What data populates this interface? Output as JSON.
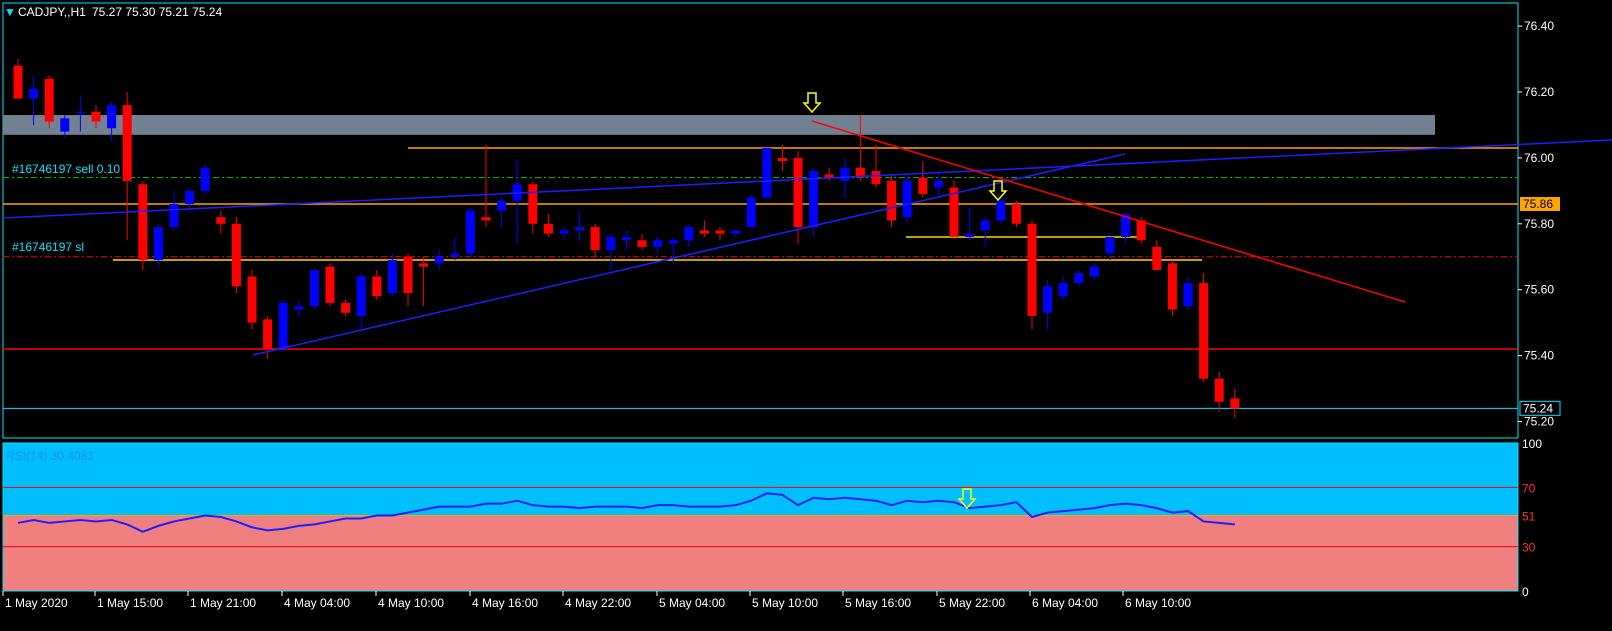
{
  "header": {
    "symbol": "CADJPY,,H1",
    "ohlc": "75.27 75.30 75.21 75.24"
  },
  "price_axis": {
    "ticks": [
      "76.40",
      "76.20",
      "76.00",
      "75.80",
      "75.60",
      "75.40",
      "75.20"
    ],
    "tag_86": "75.86",
    "tag_24": "75.24"
  },
  "orders": {
    "sell_label": "#16746197 sell 0.10",
    "sl_label": "#16746197 sl"
  },
  "rsi": {
    "label": "RSI(14) 30.4081",
    "ticks": [
      "100",
      "70",
      "51",
      "30",
      "0"
    ]
  },
  "time_axis": {
    "labels": [
      "1 May 2020",
      "1 May 15:00",
      "1 May 21:00",
      "4 May 04:00",
      "4 May 10:00",
      "4 May 16:00",
      "4 May 22:00",
      "5 May 04:00",
      "5 May 10:00",
      "5 May 16:00",
      "5 May 22:00",
      "6 May 04:00",
      "6 May 10:00"
    ]
  },
  "colors": {
    "bull": "#0000ff",
    "bear": "#ff0000",
    "grid": "#00e5ff",
    "orange": "#ffa500",
    "rsi_top": "#00bfff",
    "rsi_bottom": "#f08080",
    "arrow": "#ffff00"
  },
  "chart_data": {
    "type": "candlestick",
    "ylim": [
      75.15,
      76.47
    ],
    "candles": [
      {
        "o": 76.28,
        "h": 76.3,
        "l": 76.18,
        "c": 76.18
      },
      {
        "o": 76.18,
        "h": 76.25,
        "l": 76.1,
        "c": 76.21
      },
      {
        "o": 76.24,
        "h": 76.25,
        "l": 76.09,
        "c": 76.11
      },
      {
        "o": 76.08,
        "h": 76.13,
        "l": 76.06,
        "c": 76.12
      },
      {
        "o": 76.14,
        "h": 76.19,
        "l": 76.08,
        "c": 76.14
      },
      {
        "o": 76.14,
        "h": 76.16,
        "l": 76.09,
        "c": 76.11
      },
      {
        "o": 76.09,
        "h": 76.17,
        "l": 76.05,
        "c": 76.16
      },
      {
        "o": 76.16,
        "h": 76.2,
        "l": 75.75,
        "c": 75.93
      },
      {
        "o": 75.92,
        "h": 75.93,
        "l": 75.66,
        "c": 75.69
      },
      {
        "o": 75.69,
        "h": 75.8,
        "l": 75.67,
        "c": 75.79
      },
      {
        "o": 75.79,
        "h": 75.9,
        "l": 75.78,
        "c": 75.86
      },
      {
        "o": 75.86,
        "h": 75.91,
        "l": 75.84,
        "c": 75.9
      },
      {
        "o": 75.9,
        "h": 75.98,
        "l": 75.89,
        "c": 75.97
      },
      {
        "o": 75.82,
        "h": 75.84,
        "l": 75.77,
        "c": 75.8
      },
      {
        "o": 75.8,
        "h": 75.82,
        "l": 75.59,
        "c": 75.61
      },
      {
        "o": 75.64,
        "h": 75.66,
        "l": 75.48,
        "c": 75.5
      },
      {
        "o": 75.51,
        "h": 75.52,
        "l": 75.39,
        "c": 75.42
      },
      {
        "o": 75.42,
        "h": 75.57,
        "l": 75.41,
        "c": 75.56
      },
      {
        "o": 75.54,
        "h": 75.57,
        "l": 75.52,
        "c": 75.55
      },
      {
        "o": 75.55,
        "h": 75.66,
        "l": 75.54,
        "c": 75.66
      },
      {
        "o": 75.67,
        "h": 75.68,
        "l": 75.55,
        "c": 75.56
      },
      {
        "o": 75.56,
        "h": 75.57,
        "l": 75.52,
        "c": 75.53
      },
      {
        "o": 75.52,
        "h": 75.65,
        "l": 75.48,
        "c": 75.64
      },
      {
        "o": 75.64,
        "h": 75.66,
        "l": 75.57,
        "c": 75.58
      },
      {
        "o": 75.59,
        "h": 75.71,
        "l": 75.58,
        "c": 75.69
      },
      {
        "o": 75.7,
        "h": 75.71,
        "l": 75.55,
        "c": 75.59
      },
      {
        "o": 75.68,
        "h": 75.7,
        "l": 75.55,
        "c": 75.67
      },
      {
        "o": 75.68,
        "h": 75.72,
        "l": 75.66,
        "c": 75.7
      },
      {
        "o": 75.7,
        "h": 75.76,
        "l": 75.69,
        "c": 75.71
      },
      {
        "o": 75.71,
        "h": 75.85,
        "l": 75.7,
        "c": 75.84
      },
      {
        "o": 75.82,
        "h": 76.04,
        "l": 75.79,
        "c": 75.81
      },
      {
        "o": 75.84,
        "h": 75.88,
        "l": 75.79,
        "c": 75.87
      },
      {
        "o": 75.87,
        "h": 75.99,
        "l": 75.74,
        "c": 75.92
      },
      {
        "o": 75.92,
        "h": 75.93,
        "l": 75.77,
        "c": 75.8
      },
      {
        "o": 75.8,
        "h": 75.83,
        "l": 75.76,
        "c": 75.77
      },
      {
        "o": 75.77,
        "h": 75.79,
        "l": 75.75,
        "c": 75.78
      },
      {
        "o": 75.78,
        "h": 75.84,
        "l": 75.75,
        "c": 75.79
      },
      {
        "o": 75.79,
        "h": 75.8,
        "l": 75.7,
        "c": 75.72
      },
      {
        "o": 75.72,
        "h": 75.77,
        "l": 75.66,
        "c": 75.76
      },
      {
        "o": 75.75,
        "h": 75.78,
        "l": 75.72,
        "c": 75.76
      },
      {
        "o": 75.75,
        "h": 75.77,
        "l": 75.72,
        "c": 75.73
      },
      {
        "o": 75.73,
        "h": 75.76,
        "l": 75.71,
        "c": 75.75
      },
      {
        "o": 75.74,
        "h": 75.76,
        "l": 75.68,
        "c": 75.75
      },
      {
        "o": 75.75,
        "h": 75.8,
        "l": 75.73,
        "c": 75.79
      },
      {
        "o": 75.78,
        "h": 75.81,
        "l": 75.76,
        "c": 75.77
      },
      {
        "o": 75.78,
        "h": 75.79,
        "l": 75.75,
        "c": 75.77
      },
      {
        "o": 75.77,
        "h": 75.78,
        "l": 75.76,
        "c": 75.78
      },
      {
        "o": 75.79,
        "h": 75.89,
        "l": 75.79,
        "c": 75.88
      },
      {
        "o": 75.88,
        "h": 76.03,
        "l": 75.87,
        "c": 76.03
      },
      {
        "o": 76.0,
        "h": 76.04,
        "l": 75.96,
        "c": 75.99
      },
      {
        "o": 76.0,
        "h": 76.02,
        "l": 75.74,
        "c": 75.79
      },
      {
        "o": 75.79,
        "h": 75.97,
        "l": 75.76,
        "c": 75.96
      },
      {
        "o": 75.95,
        "h": 75.97,
        "l": 75.93,
        "c": 75.94
      },
      {
        "o": 75.93,
        "h": 76.0,
        "l": 75.88,
        "c": 75.97
      },
      {
        "o": 75.97,
        "h": 76.13,
        "l": 75.93,
        "c": 75.94
      },
      {
        "o": 75.96,
        "h": 76.04,
        "l": 75.91,
        "c": 75.92
      },
      {
        "o": 75.93,
        "h": 75.95,
        "l": 75.79,
        "c": 75.81
      },
      {
        "o": 75.82,
        "h": 75.95,
        "l": 75.8,
        "c": 75.93
      },
      {
        "o": 75.94,
        "h": 75.99,
        "l": 75.88,
        "c": 75.89
      },
      {
        "o": 75.91,
        "h": 75.96,
        "l": 75.88,
        "c": 75.93
      },
      {
        "o": 75.91,
        "h": 75.93,
        "l": 75.76,
        "c": 75.76
      },
      {
        "o": 75.76,
        "h": 75.85,
        "l": 75.75,
        "c": 75.77
      },
      {
        "o": 75.78,
        "h": 75.82,
        "l": 75.73,
        "c": 75.81
      },
      {
        "o": 75.81,
        "h": 75.88,
        "l": 75.8,
        "c": 75.87
      },
      {
        "o": 75.86,
        "h": 75.87,
        "l": 75.79,
        "c": 75.8
      },
      {
        "o": 75.8,
        "h": 75.81,
        "l": 75.48,
        "c": 75.52
      },
      {
        "o": 75.53,
        "h": 75.63,
        "l": 75.48,
        "c": 75.61
      },
      {
        "o": 75.58,
        "h": 75.64,
        "l": 75.57,
        "c": 75.62
      },
      {
        "o": 75.62,
        "h": 75.66,
        "l": 75.61,
        "c": 75.65
      },
      {
        "o": 75.64,
        "h": 75.68,
        "l": 75.63,
        "c": 75.67
      },
      {
        "o": 75.71,
        "h": 75.73,
        "l": 75.69,
        "c": 75.76
      },
      {
        "o": 75.76,
        "h": 75.83,
        "l": 75.74,
        "c": 75.83
      },
      {
        "o": 75.81,
        "h": 75.82,
        "l": 75.74,
        "c": 75.75
      },
      {
        "o": 75.73,
        "h": 75.75,
        "l": 75.66,
        "c": 75.66
      },
      {
        "o": 75.68,
        "h": 75.69,
        "l": 75.52,
        "c": 75.54
      },
      {
        "o": 75.55,
        "h": 75.64,
        "l": 75.54,
        "c": 75.62
      },
      {
        "o": 75.62,
        "h": 75.65,
        "l": 75.32,
        "c": 75.33
      },
      {
        "o": 75.33,
        "h": 75.35,
        "l": 75.23,
        "c": 75.26
      },
      {
        "o": 75.27,
        "h": 75.3,
        "l": 75.21,
        "c": 75.24
      }
    ],
    "rsi_values": [
      46,
      48,
      46,
      47,
      48,
      47,
      48,
      45,
      40,
      44,
      47,
      49,
      51,
      50,
      47,
      43,
      41,
      42,
      44,
      45,
      47,
      49,
      49,
      51,
      51,
      53,
      55,
      57,
      57,
      57,
      59,
      59,
      61,
      58,
      57,
      57,
      56,
      57,
      57,
      57,
      56,
      58,
      58,
      57,
      57,
      57,
      58,
      61,
      66,
      65,
      58,
      63,
      62,
      63,
      62,
      61,
      58,
      61,
      60,
      61,
      60,
      56,
      57,
      58,
      60,
      50,
      53,
      54,
      55,
      56,
      58,
      59,
      58,
      56,
      53,
      54,
      47,
      46,
      45
    ],
    "rsi_levels": [
      70,
      51,
      30
    ],
    "levels": {
      "top_zone": [
        76.07,
        76.13
      ],
      "orange_upper": 76.03,
      "sell_entry": 75.94,
      "orange_mid": 75.86,
      "sl": 75.7,
      "red_horizontal": 75.42,
      "current": 75.24,
      "yellow_short": 75.76,
      "orange_lower": 75.69
    }
  }
}
